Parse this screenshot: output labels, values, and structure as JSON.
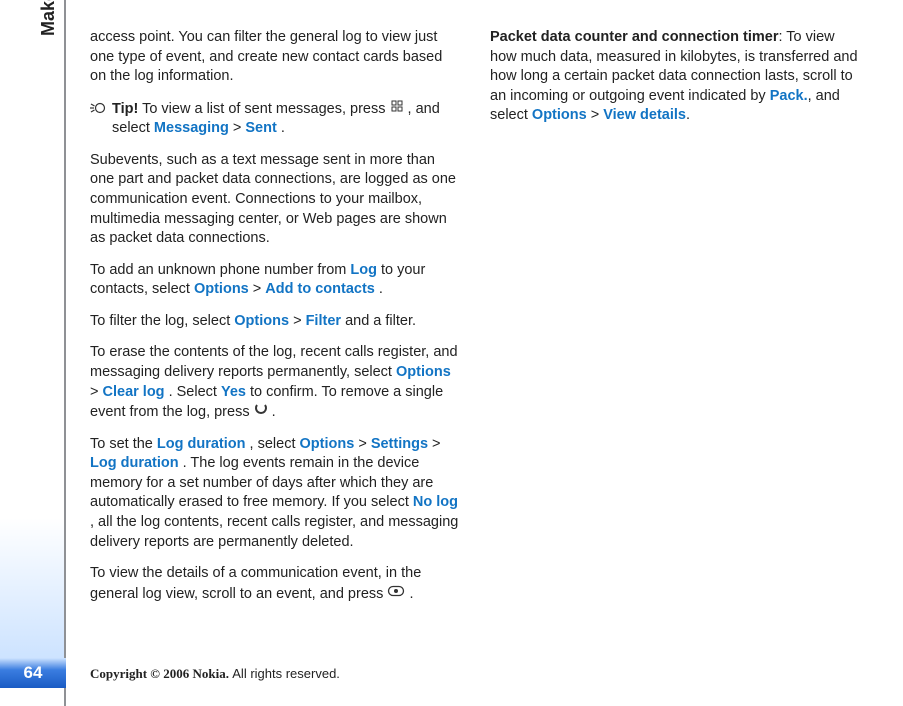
{
  "gutter": {
    "section_title": "Make calls",
    "page_number": "64"
  },
  "col1": {
    "p1": "access point. You can filter the general log to view just one type of event, and create new contact cards based on the log information.",
    "tip_label": "Tip!",
    "tip_a": "To view a list of sent messages, press ",
    "tip_b": ", and select ",
    "tip_link1": "Messaging",
    "tip_gt1": " > ",
    "tip_link2": "Sent",
    "tip_end": ".",
    "p2": "Subevents, such as a text message sent in more than one part and packet data connections, are logged as one communication event. Connections to your mailbox, multimedia messaging center, or Web pages are shown as packet data connections.",
    "p3_a": "To add an unknown phone number from ",
    "p3_link1": "Log",
    "p3_b": " to your contacts, select ",
    "p3_link2": "Options",
    "p3_gt1": " > ",
    "p3_link3": "Add to contacts",
    "p3_end": ".",
    "p4_a": "To filter the log, select ",
    "p4_link1": "Options",
    "p4_gt1": " > ",
    "p4_link2": "Filter",
    "p4_b": " and a filter.",
    "p5_a": "To erase the contents of the log, recent calls register, and messaging delivery reports permanently, select ",
    "p5_link1": "Options",
    "p5_gt1": " > ",
    "p5_link2": "Clear log",
    "p5_b": ". Select ",
    "p5_link3": "Yes",
    "p5_c": " to confirm. To remove a single event from the log, press ",
    "p5_end": " .",
    "p6_a": "To set the ",
    "p6_link1": "Log duration",
    "p6_b": ", select ",
    "p6_link2": "Options",
    "p6_gt1": " > ",
    "p6_link3": "Settings",
    "p6_gt2": " > ",
    "p6_link4": "Log duration",
    "p6_c": ". The log events remain in the device memory for a set number of days after which they are automatically erased to free memory. If you select ",
    "p6_link5": "No log",
    "p6_d": ", all the log contents, recent calls register, and messaging delivery reports are permanently deleted.",
    "p7_a": "To view the details of a communication event, in the general log view, scroll to an event, and press ",
    "p7_end": " ."
  },
  "col2": {
    "hdr": "Packet data counter and connection timer",
    "body_a": ": To view how much data, measured in kilobytes, is transferred and how long a certain packet data connection lasts, scroll to an incoming or outgoing event indicated by ",
    "link1": "Pack.",
    "body_b": ", and select ",
    "link2": "Options",
    "gt1": " > ",
    "link3": "View details",
    "end": "."
  },
  "footer": {
    "copyright_prefix": "Copyright © 2006 Nokia. ",
    "copyright_suffix": "All rights reserved."
  }
}
